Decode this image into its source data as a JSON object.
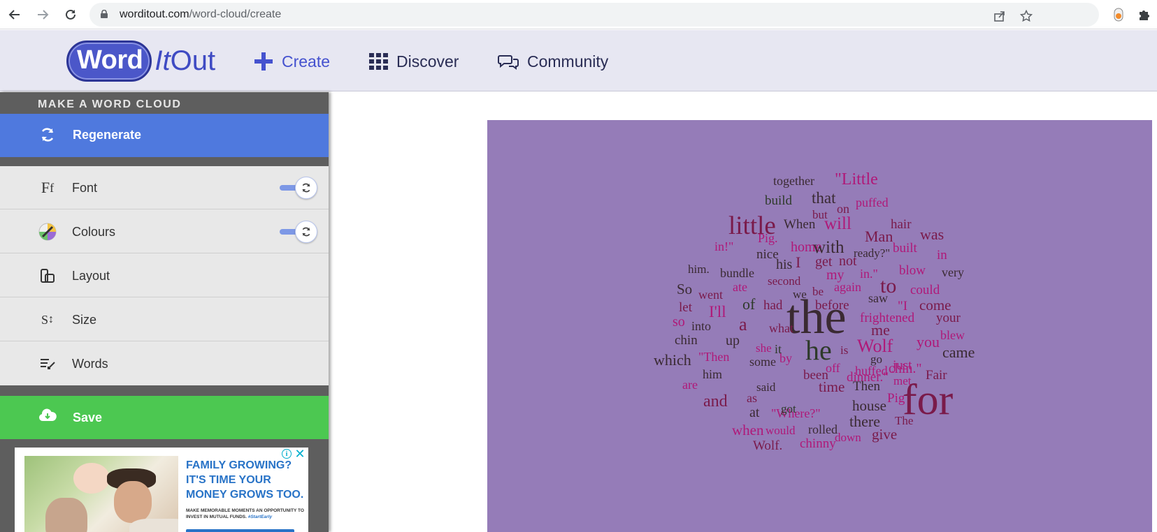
{
  "browser": {
    "url_host": "worditout.com",
    "url_path": "/word-cloud/create",
    "icons": [
      "back-arrow-icon",
      "forward-arrow-icon",
      "reload-icon",
      "lock-icon",
      "share-icon",
      "star-icon",
      "extension-icon",
      "puzzle-icon"
    ]
  },
  "header": {
    "logo_word": "Word",
    "logo_it": "It",
    "logo_out": "Out",
    "nav": [
      {
        "label": "Create",
        "icon": "plus-icon"
      },
      {
        "label": "Discover",
        "icon": "grid-icon"
      },
      {
        "label": "Community",
        "icon": "chat-bubbles-icon"
      }
    ]
  },
  "sidebar": {
    "heading": "MAKE A WORD CLOUD",
    "regenerate_label": "Regenerate",
    "options": [
      {
        "label": "Font",
        "icon": "font-icon",
        "toggle": true
      },
      {
        "label": "Colours",
        "icon": "palette-icon",
        "toggle": true
      },
      {
        "label": "Layout",
        "icon": "layout-icon",
        "toggle": false
      },
      {
        "label": "Size",
        "icon": "size-icon",
        "toggle": false
      },
      {
        "label": "Words",
        "icon": "words-icon",
        "toggle": false
      }
    ],
    "save_label": "Save"
  },
  "ad": {
    "headline": "FAMILY GROWING? IT'S TIME YOUR MONEY GROWS TOO.",
    "small_text": "MAKE MEMORABLE MOMENTS AN OPPORTUNITY TO INVEST IN MUTUAL FUNDS.",
    "hashtag": "#StartEarly",
    "info_glyph": "i",
    "close_glyph": "✕"
  },
  "colors": {
    "canvas_bg": "#957cb8",
    "dark": "#3a2a32",
    "maroon": "#7a1a4a",
    "magenta": "#b01878",
    "green": "#2e3a2a",
    "accent": "#4f79de",
    "save": "#4cc851"
  },
  "word_cloud": [
    {
      "text": "together",
      "c": "dark"
    },
    {
      "text": "\"Little",
      "c": "magenta"
    },
    {
      "text": "build",
      "c": "green"
    },
    {
      "text": "that",
      "c": "dark"
    },
    {
      "text": "on",
      "c": "maroon"
    },
    {
      "text": "puffed",
      "c": "magenta"
    },
    {
      "text": "but",
      "c": "maroon"
    },
    {
      "text": "little",
      "c": "maroon"
    },
    {
      "text": "When",
      "c": "dark"
    },
    {
      "text": "will",
      "c": "magenta"
    },
    {
      "text": "hair",
      "c": "maroon"
    },
    {
      "text": "Man",
      "c": "maroon"
    },
    {
      "text": "was",
      "c": "maroon"
    },
    {
      "text": "Pig.",
      "c": "magenta"
    },
    {
      "text": "in!\"",
      "c": "magenta"
    },
    {
      "text": "home",
      "c": "magenta"
    },
    {
      "text": "with",
      "c": "dark"
    },
    {
      "text": "built",
      "c": "magenta"
    },
    {
      "text": "nice",
      "c": "dark"
    },
    {
      "text": "ready?\"",
      "c": "dark"
    },
    {
      "text": "in",
      "c": "magenta"
    },
    {
      "text": "his",
      "c": "dark"
    },
    {
      "text": "I",
      "c": "maroon"
    },
    {
      "text": "get",
      "c": "maroon"
    },
    {
      "text": "not",
      "c": "maroon"
    },
    {
      "text": "him.",
      "c": "dark"
    },
    {
      "text": "bundle",
      "c": "dark"
    },
    {
      "text": "my",
      "c": "magenta"
    },
    {
      "text": "in.\"",
      "c": "magenta"
    },
    {
      "text": "blow",
      "c": "magenta"
    },
    {
      "text": "very",
      "c": "dark"
    },
    {
      "text": "second",
      "c": "maroon"
    },
    {
      "text": "to",
      "c": "maroon"
    },
    {
      "text": "So",
      "c": "dark"
    },
    {
      "text": "ate",
      "c": "magenta"
    },
    {
      "text": "be",
      "c": "maroon"
    },
    {
      "text": "again",
      "c": "magenta"
    },
    {
      "text": "could",
      "c": "magenta"
    },
    {
      "text": "went",
      "c": "maroon"
    },
    {
      "text": "we",
      "c": "dark"
    },
    {
      "text": "saw",
      "c": "dark"
    },
    {
      "text": "of",
      "c": "green"
    },
    {
      "text": "had",
      "c": "maroon"
    },
    {
      "text": "before",
      "c": "maroon"
    },
    {
      "text": "\"I",
      "c": "magenta"
    },
    {
      "text": "come",
      "c": "maroon"
    },
    {
      "text": "let",
      "c": "maroon"
    },
    {
      "text": "I'll",
      "c": "magenta"
    },
    {
      "text": "the",
      "c": "dark"
    },
    {
      "text": "frightened",
      "c": "magenta"
    },
    {
      "text": "your",
      "c": "maroon"
    },
    {
      "text": "so",
      "c": "magenta"
    },
    {
      "text": "a",
      "c": "maroon"
    },
    {
      "text": "into",
      "c": "dark"
    },
    {
      "text": "what",
      "c": "maroon"
    },
    {
      "text": "me",
      "c": "maroon"
    },
    {
      "text": "blew",
      "c": "magenta"
    },
    {
      "text": "chin",
      "c": "dark"
    },
    {
      "text": "up",
      "c": "dark"
    },
    {
      "text": "you",
      "c": "magenta"
    },
    {
      "text": "she",
      "c": "magenta"
    },
    {
      "text": "it",
      "c": "green"
    },
    {
      "text": "he",
      "c": "green"
    },
    {
      "text": "is",
      "c": "maroon"
    },
    {
      "text": "Wolf",
      "c": "magenta"
    },
    {
      "text": "came",
      "c": "dark"
    },
    {
      "text": "which",
      "c": "dark"
    },
    {
      "text": "\"Then",
      "c": "magenta"
    },
    {
      "text": "by",
      "c": "magenta"
    },
    {
      "text": "some",
      "c": "dark"
    },
    {
      "text": "go",
      "c": "dark"
    },
    {
      "text": "just",
      "c": "magenta"
    },
    {
      "text": "off",
      "c": "magenta"
    },
    {
      "text": "huffed",
      "c": "magenta"
    },
    {
      "text": "chin.\"",
      "c": "magenta"
    },
    {
      "text": "him",
      "c": "dark"
    },
    {
      "text": "been",
      "c": "maroon"
    },
    {
      "text": "dinner.\"",
      "c": "magenta"
    },
    {
      "text": "met",
      "c": "magenta"
    },
    {
      "text": "Fair",
      "c": "maroon"
    },
    {
      "text": "are",
      "c": "magenta"
    },
    {
      "text": "said",
      "c": "dark"
    },
    {
      "text": "time",
      "c": "maroon"
    },
    {
      "text": "Then",
      "c": "dark"
    },
    {
      "text": "as",
      "c": "maroon"
    },
    {
      "text": "Pig",
      "c": "magenta"
    },
    {
      "text": "and",
      "c": "maroon"
    },
    {
      "text": "for",
      "c": "maroon"
    },
    {
      "text": "at",
      "c": "dark"
    },
    {
      "text": "\"Where?\"",
      "c": "magenta"
    },
    {
      "text": "got",
      "c": "green"
    },
    {
      "text": "house",
      "c": "dark"
    },
    {
      "text": "there",
      "c": "dark"
    },
    {
      "text": "The",
      "c": "maroon"
    },
    {
      "text": "when",
      "c": "magenta"
    },
    {
      "text": "would",
      "c": "magenta"
    },
    {
      "text": "rolled",
      "c": "dark"
    },
    {
      "text": "down",
      "c": "magenta"
    },
    {
      "text": "give",
      "c": "maroon"
    },
    {
      "text": "Wolf.",
      "c": "maroon"
    },
    {
      "text": "chinny",
      "c": "magenta"
    }
  ]
}
